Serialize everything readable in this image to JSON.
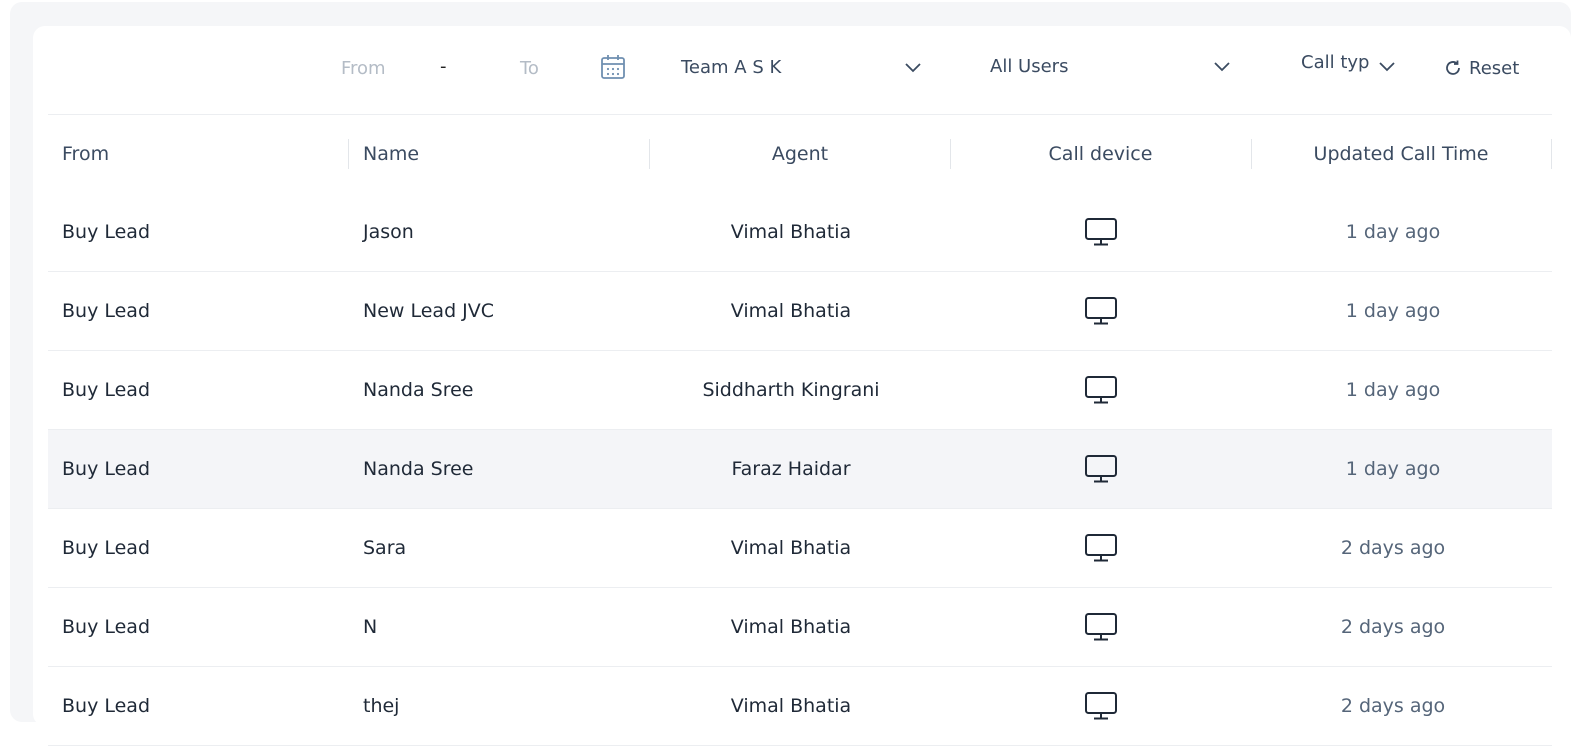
{
  "filters": {
    "from_placeholder": "From",
    "separator": "-",
    "to_placeholder": "To",
    "team_selected": "Team A S K",
    "users_selected": "All Users",
    "call_type_label": "Call type",
    "reset_label": "Reset"
  },
  "table": {
    "columns": [
      "From",
      "Name",
      "Agent",
      "Call device",
      "Updated Call Time"
    ],
    "rows": [
      {
        "from": "Buy Lead",
        "name": "Jason",
        "agent": "Vimal Bhatia",
        "device": "desktop-icon",
        "time": "1 day ago"
      },
      {
        "from": "Buy Lead",
        "name": "New Lead JVC",
        "agent": "Vimal Bhatia",
        "device": "desktop-icon",
        "time": "1 day ago"
      },
      {
        "from": "Buy Lead",
        "name": "Nanda Sree",
        "agent": "Siddharth Kingrani",
        "device": "desktop-icon",
        "time": "1 day ago"
      },
      {
        "from": "Buy Lead",
        "name": "Nanda Sree",
        "agent": "Faraz Haidar",
        "device": "desktop-icon",
        "time": "1 day ago"
      },
      {
        "from": "Buy Lead",
        "name": "Sara",
        "agent": "Vimal Bhatia",
        "device": "desktop-icon",
        "time": "2 days ago"
      },
      {
        "from": "Buy Lead",
        "name": "N",
        "agent": "Vimal Bhatia",
        "device": "desktop-icon",
        "time": "2 days ago"
      },
      {
        "from": "Buy Lead",
        "name": "thej",
        "agent": "Vimal Bhatia",
        "device": "desktop-icon",
        "time": "2 days ago"
      }
    ]
  },
  "colors": {
    "header_text": "#3b4b61",
    "row_highlight": "#f4f5f8",
    "placeholder": "#b4bcc6"
  }
}
